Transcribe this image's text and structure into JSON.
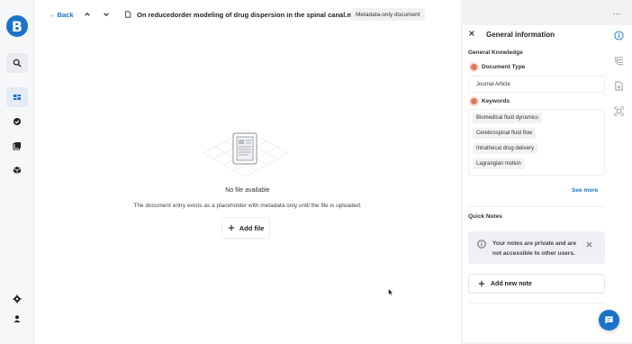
{
  "app": {
    "logo_letter": "B",
    "accent": "#1a73c9"
  },
  "rail": {
    "items": [
      {
        "icon": "search-icon"
      },
      {
        "icon": "dashboard-icon"
      },
      {
        "icon": "check-circle-icon"
      },
      {
        "icon": "library-icon"
      },
      {
        "icon": "package-icon"
      },
      {
        "icon": "gear-icon"
      },
      {
        "icon": "user-icon"
      }
    ]
  },
  "toolbar": {
    "back_label": "← Back",
    "doc_title": "On reducedorder modeling of drug dispersion in the spinal canal.metadata",
    "badge": "Metadata-only document",
    "more_label": "···"
  },
  "empty_state": {
    "title": "No file available",
    "subtitle": "The document entry exists as a placeholder with metadata only until the file is uploaded.",
    "add_file_label": "Add file"
  },
  "panel": {
    "title": "General information",
    "section_general": "General Knowledge",
    "doc_type_label": "Document Type",
    "doc_type_value": "Journal Article",
    "keywords_label": "Keywords",
    "keywords": [
      "Biomedical fluid dynamics",
      "Cerebrospinal fluid flow",
      "Intrathecal drug delivery",
      "Lagrangian motion"
    ],
    "see_more": "See more",
    "section_notes": "Quick Notes",
    "notes_info": "Your notes are private and are not accessible to other users.",
    "add_note_label": "Add new note"
  },
  "side_tools": [
    "info-icon",
    "outline-icon",
    "add-document-icon",
    "scan-icon"
  ]
}
